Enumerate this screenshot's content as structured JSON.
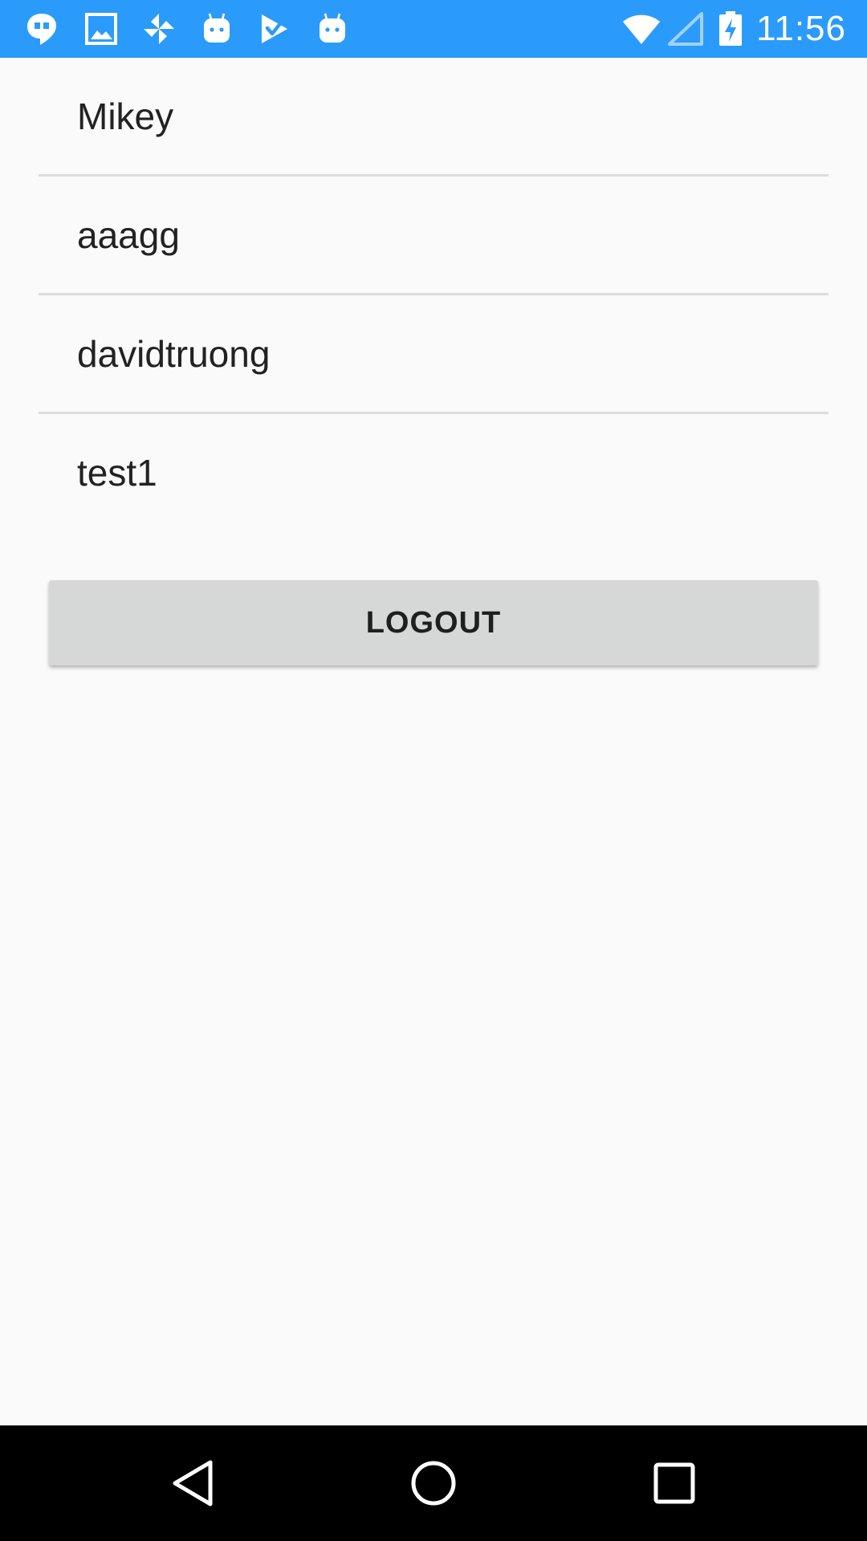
{
  "status_bar": {
    "time": "11:56",
    "notification_icons": [
      "hangouts-icon",
      "image-icon",
      "pinwheel-icon",
      "android-icon",
      "play-store-icon",
      "android-icon"
    ],
    "system_icons": [
      "wifi-icon",
      "cellular-signal-icon",
      "battery-charging-icon"
    ],
    "background_color": "#2B9BFB"
  },
  "user_list": {
    "items": [
      {
        "label": "Mikey"
      },
      {
        "label": "aaagg"
      },
      {
        "label": "davidtruong"
      },
      {
        "label": "test1"
      }
    ]
  },
  "logout_button": {
    "label": "LOGOUT"
  },
  "nav_bar": {
    "buttons": [
      "back-icon",
      "home-icon",
      "recents-icon"
    ]
  }
}
